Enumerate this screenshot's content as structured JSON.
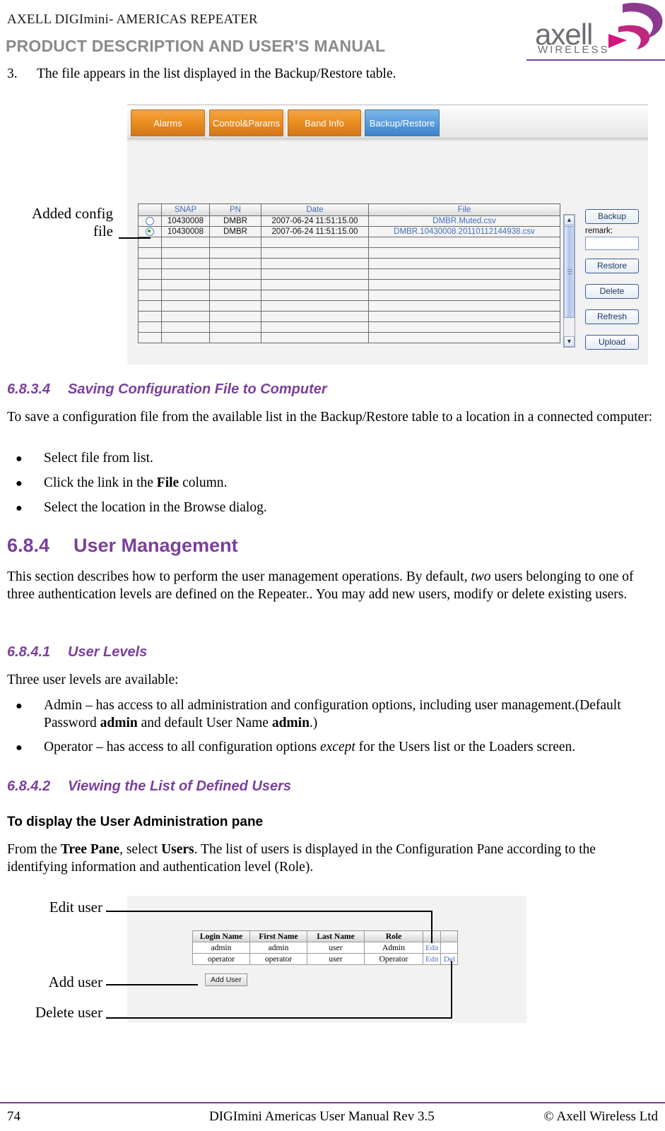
{
  "header": {
    "product_line": "AXELL DIGImini- AMERICAS REPEATER",
    "doc_title": "PRODUCT DESCRIPTION AND USER'S MANUAL",
    "logo_word": "axell",
    "logo_sub": "WIRELESS",
    "accent_color": "#7B3F9D",
    "logo_gray": "#6d6d72",
    "logo_purple": "#8B3A8F",
    "logo_magenta": "#D4147E"
  },
  "step": {
    "number": "3.",
    "text": "The file appears in the list displayed in the Backup/Restore table."
  },
  "backup_screen": {
    "tabs": [
      {
        "label": "Alarms",
        "active": false
      },
      {
        "label": "Control&Params",
        "active": false
      },
      {
        "label": "Band Info",
        "active": false
      },
      {
        "label": "Backup/Restore",
        "active": true
      }
    ],
    "table": {
      "columns": [
        "",
        "SNAP",
        "PN",
        "Date",
        "File"
      ],
      "rows": [
        {
          "selected": false,
          "snap": "10430008",
          "pn": "DMBR",
          "date": "2007-06-24 11:51:15.00",
          "file": "DMBR.Muted.csv"
        },
        {
          "selected": true,
          "snap": "10430008",
          "pn": "DMBR",
          "date": "2007-06-24 11:51:15.00",
          "file": "DMBR.10430008.20110112144938.csv"
        }
      ],
      "empty_row_count": 10
    },
    "buttons": {
      "backup": "Backup",
      "remark_label": "remark:",
      "remark_value": "",
      "restore": "Restore",
      "delete": "Delete",
      "refresh": "Refresh",
      "upload": "Upload"
    },
    "callout": {
      "line1": "Added config",
      "line2": "file"
    }
  },
  "section_6834": {
    "number": "6.8.3.4",
    "title": "Saving Configuration File to Computer",
    "intro_line1": "To save a configuration file from the available list in the Backup/Restore table to a location in a",
    "intro_line2": "connected computer:",
    "bullets": [
      {
        "pre": "Select file from list.",
        "bold": "",
        "post": ""
      },
      {
        "pre": "Click the link in the ",
        "bold": "File",
        "post": " column."
      },
      {
        "pre": "Select the location in the Browse dialog.",
        "bold": "",
        "post": ""
      }
    ]
  },
  "section_684": {
    "number": "6.8.4",
    "title": "User Management",
    "para_a": "This section describes how to perform the user management operations. By default, ",
    "para_italic": "two",
    "para_b": " users",
    "para_line2": "belonging to one of three authentication levels are defined on the Repeater.. You may add new users,",
    "para_line3": "modify or delete existing users."
  },
  "section_6841": {
    "number": "6.8.4.1",
    "title": "User Levels",
    "intro": "Three user levels are available:",
    "bullet1_line1": "Admin – has access to all administration and configuration options, including user management.",
    "bullet1_line2_a": "(Default Password ",
    "bullet1_line2_bold1": "admin",
    "bullet1_line2_b": " and default User Name ",
    "bullet1_line2_bold2": "admin",
    "bullet1_line2_c": ".)",
    "bullet2_a": "Operator – has access to all configuration options ",
    "bullet2_italic": "except",
    "bullet2_b": " for the Users list or the Loaders screen."
  },
  "section_6842": {
    "number": "6.8.4.2",
    "title": "Viewing the List of Defined Users",
    "subhead": "To display the User Administration pane",
    "para_a": "From the ",
    "para_bold1": "Tree Pane",
    "para_b": ", select ",
    "para_bold2": "Users",
    "para_c": ". The list of users is displayed in the Configuration Pane according",
    "para_line2": "to the identifying information and authentication level (Role)."
  },
  "user_screen": {
    "table": {
      "columns": [
        "Login Name",
        "First Name",
        "Last Name",
        "Role",
        "",
        ""
      ],
      "rows": [
        {
          "login": "admin",
          "first": "admin",
          "last": "user",
          "role": "Admin",
          "edit": "Edit",
          "del": ""
        },
        {
          "login": "operator",
          "first": "operator",
          "last": "user",
          "role": "Operator",
          "edit": "Edit",
          "del": "Del"
        }
      ]
    },
    "add_user_button": "Add User",
    "callouts": {
      "edit_user": "Edit user",
      "add_user": "Add user",
      "delete_user": "Delete user"
    }
  },
  "footer": {
    "page_number": "74",
    "doc_name": "DIGImini Americas User Manual Rev 3.5",
    "copyright": "© Axell Wireless Ltd"
  }
}
